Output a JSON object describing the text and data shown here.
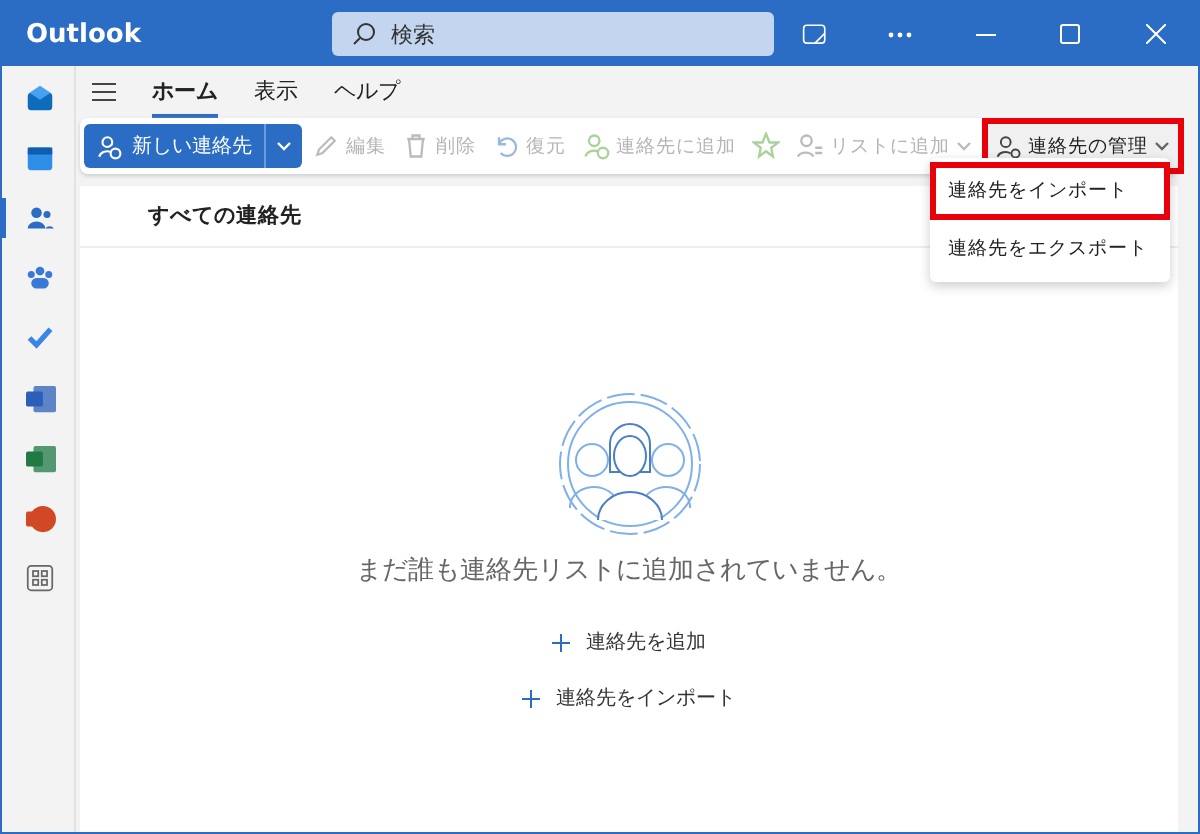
{
  "window": {
    "title": "Outlook",
    "search_placeholder": "検索"
  },
  "rail": [
    {
      "kind": "mail",
      "selected": false
    },
    {
      "kind": "calendar",
      "selected": false
    },
    {
      "kind": "people",
      "selected": true
    },
    {
      "kind": "groups",
      "selected": false
    },
    {
      "kind": "todo",
      "selected": false
    },
    {
      "kind": "word",
      "selected": false
    },
    {
      "kind": "excel",
      "selected": false
    },
    {
      "kind": "powerpoint",
      "selected": false
    },
    {
      "kind": "apps",
      "selected": false
    }
  ],
  "tabs": [
    {
      "label": "ホーム",
      "selected": true
    },
    {
      "label": "表示",
      "selected": false
    },
    {
      "label": "ヘルプ",
      "selected": false
    }
  ],
  "toolbar": {
    "new_contact": "新しい連絡先",
    "items": [
      {
        "kind": "edit",
        "label": "編集",
        "disabled": true
      },
      {
        "kind": "delete",
        "label": "削除",
        "disabled": true
      },
      {
        "kind": "restore",
        "label": "復元",
        "disabled": true
      },
      {
        "kind": "add-contact",
        "label": "連絡先に追加",
        "disabled": true
      },
      {
        "kind": "favorite",
        "disabled": true
      },
      {
        "kind": "add-list",
        "label": "リストに追加",
        "disabled": true
      }
    ],
    "manage": {
      "label": "連絡先の管理",
      "highlighted": true
    }
  },
  "menu": [
    {
      "label": "連絡先をインポート",
      "highlighted": true
    },
    {
      "label": "連絡先をエクスポート",
      "highlighted": false
    }
  ],
  "list_header": "すべての連絡先",
  "empty": {
    "message": "まだ誰も連絡先リストに追加されていません。",
    "actions": [
      "連絡先を追加",
      "連絡先をインポート"
    ]
  }
}
